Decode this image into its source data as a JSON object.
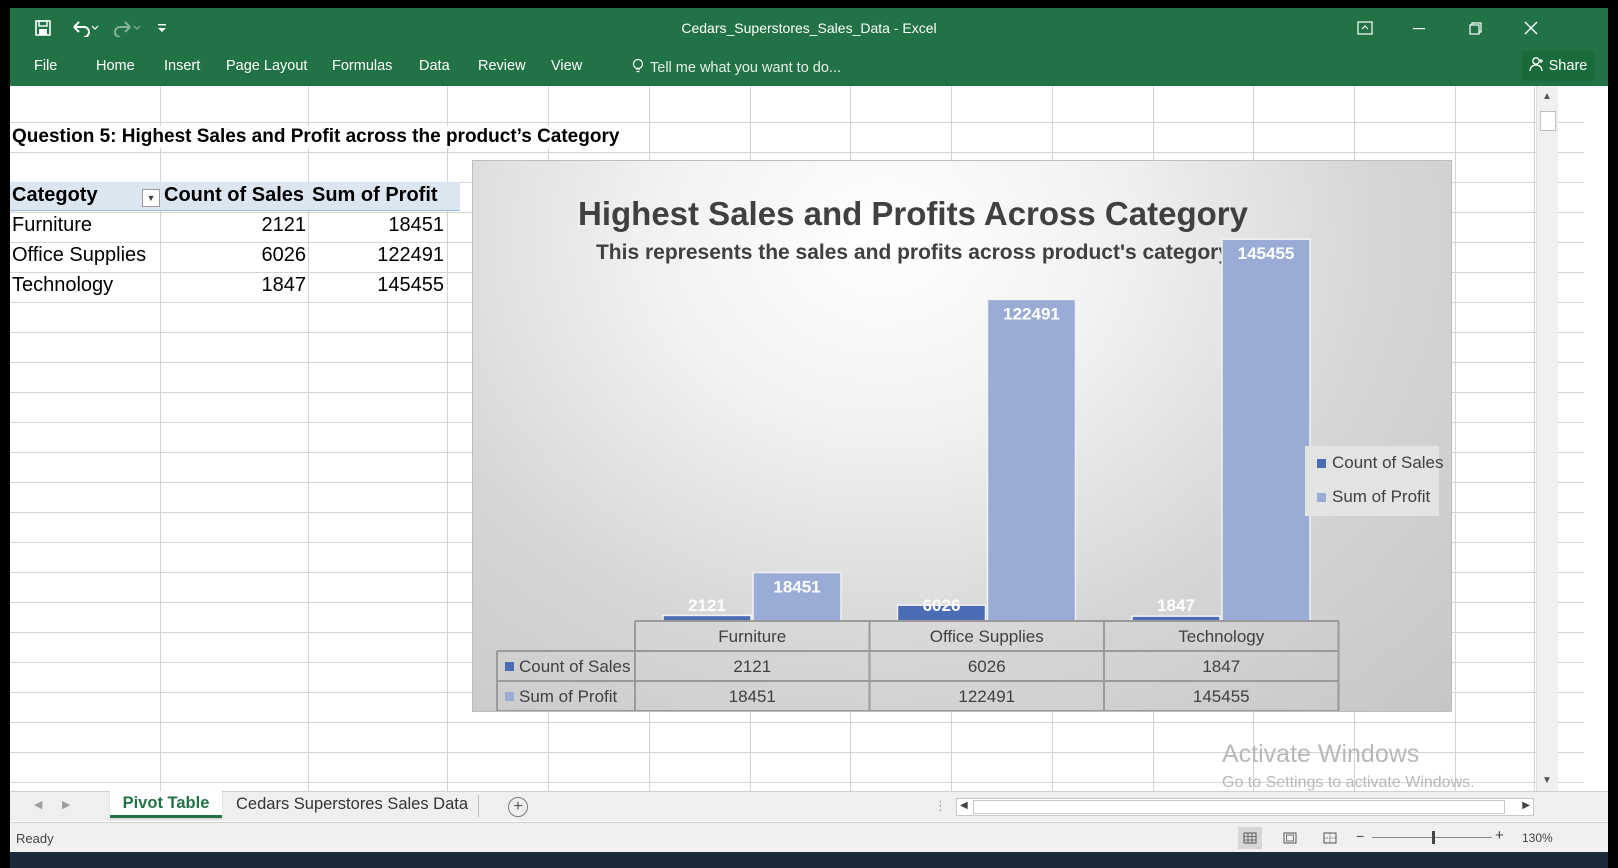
{
  "window": {
    "title": "Cedars_Superstores_Sales_Data - Excel"
  },
  "quick_access": {
    "save_icon": "save-icon",
    "undo_icon": "undo-icon",
    "redo_icon": "redo-icon",
    "customize_icon": "customize-qat-icon"
  },
  "ribbon": {
    "tabs": [
      "File",
      "Home",
      "Insert",
      "Page Layout",
      "Formulas",
      "Data",
      "Review",
      "View"
    ],
    "tell_me": "Tell me what you want to do...",
    "share": "Share"
  },
  "sheet": {
    "question": "Question 5: Highest Sales and Profit across the product’s Category",
    "pivot": {
      "headers": [
        "Categoty",
        "Count of Sales",
        "Sum of Profit"
      ],
      "rows": [
        [
          "Furniture",
          "2121",
          "18451"
        ],
        [
          "Office Supplies",
          "6026",
          "122491"
        ],
        [
          "Technology",
          "1847",
          "145455"
        ]
      ]
    }
  },
  "chart_data": {
    "type": "bar",
    "title": "Highest Sales and Profits Across Category",
    "subtitle": "This represents the sales and profits across product's category",
    "categories": [
      "Furniture",
      "Office Supplies",
      "Technology"
    ],
    "series": [
      {
        "name": "Count of Sales",
        "values": [
          2121,
          6026,
          1847
        ],
        "color": "#4a6db5"
      },
      {
        "name": "Sum of Profit",
        "values": [
          18451,
          122491,
          145455
        ],
        "color": "#9aacd6"
      }
    ],
    "ylim": [
      0,
      160000
    ],
    "legend": "right",
    "data_table": true,
    "grid": false
  },
  "sheet_tabs": {
    "active": "Pivot Table",
    "other": "Cedars Superstores Sales Data"
  },
  "status": {
    "ready": "Ready",
    "zoom": "130%"
  },
  "watermark": {
    "title": "Activate Windows",
    "subtitle": "Go to Settings to activate Windows."
  },
  "colors": {
    "excel_green": "#217346",
    "count_series": "#4a6db5",
    "profit_series": "#9aacd6"
  }
}
